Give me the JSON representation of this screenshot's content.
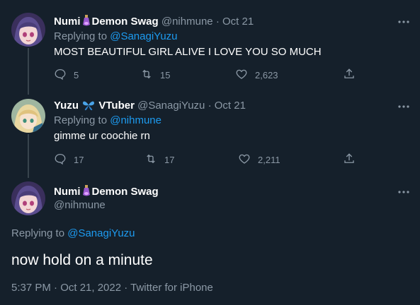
{
  "tweets": [
    {
      "name_part1": "Numi",
      "name_part2": "Demon Swag",
      "handle": "@nihmune",
      "separator": "·",
      "date": "Oct 21",
      "replying_prefix": "Replying to",
      "replying_to": "@SanagiYuzu",
      "text": "MOST BEAUTIFUL GIRL ALIVE I LOVE YOU SO MUCH",
      "replies": "5",
      "retweets": "15",
      "likes": "2,623"
    },
    {
      "name_part1": "Yuzu",
      "name_part2": "VTuber",
      "handle": "@SanagiYuzu",
      "separator": "·",
      "date": "Oct 21",
      "replying_prefix": "Replying to",
      "replying_to": "@nihmune",
      "text": "gimme ur coochie rn",
      "replies": "17",
      "retweets": "17",
      "likes": "2,211"
    }
  ],
  "main_tweet": {
    "name_part1": "Numi",
    "name_part2": "Demon Swag",
    "handle": "@nihmune",
    "replying_prefix": "Replying to",
    "replying_to": "@SanagiYuzu",
    "text": "now hold on a minute",
    "meta": "5:37 PM · Oct 21, 2022 · Twitter for iPhone"
  },
  "icons": {
    "reply": "reply-icon",
    "retweet": "retweet-icon",
    "like": "heart-icon",
    "share": "share-icon",
    "more": "more-icon",
    "emoji1": "potion-emoji-icon",
    "emoji2": "butterfly-emoji-icon"
  },
  "colors": {
    "background": "#15202b",
    "text": "#ffffff",
    "secondary": "#8b98a5",
    "link": "#1d9bf0",
    "thread_line": "#38444d"
  }
}
